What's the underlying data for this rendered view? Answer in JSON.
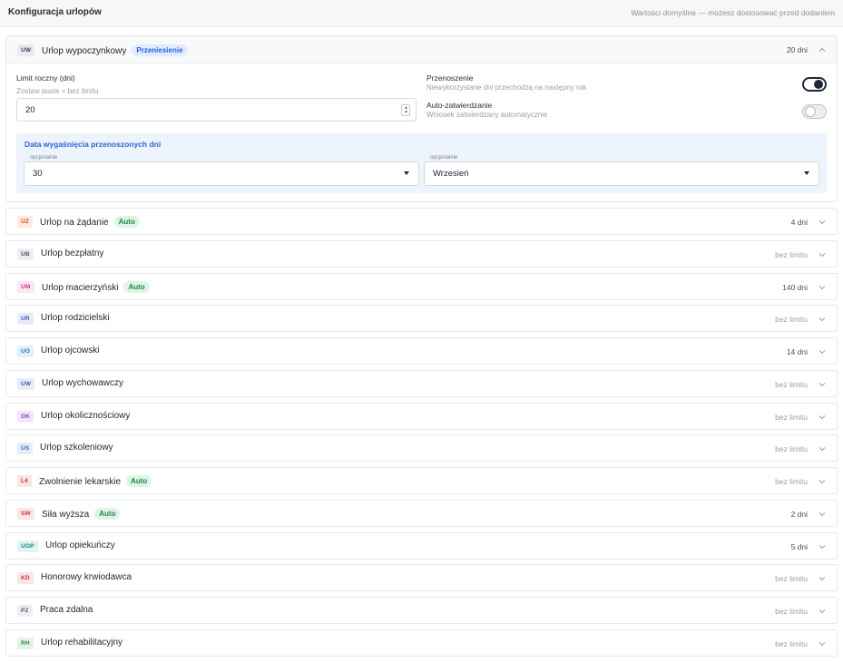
{
  "header": {
    "title": "Konfiguracja urlopów",
    "note": "Wartości domyślne — możesz dostosować przed dodaniem"
  },
  "expanded": {
    "abbr": "UW",
    "name": "Urlop wypoczynkowy",
    "badge": "Przeniesienie",
    "days": "20 dni",
    "limit_label": "Limit roczny (dni)",
    "limit_hint": "Zostaw puste = bez limitu",
    "limit_value": "20",
    "carry_label": "Przenoszenie",
    "carry_hint": "Niewykorzystane dni przechodzą na następny rok",
    "carry_on": true,
    "auto_label": "Auto-zatwierdzanie",
    "auto_hint": "Wniosek zatwierdzany automatycznie",
    "auto_on": false,
    "expiry_title": "Data wygaśnięcia przenoszonych dni",
    "day_caption": "opcjonalnie",
    "day_value": "30",
    "month_caption": "opcjonalnie",
    "month_value": "Wrzesień",
    "abbr_colors": {
      "bg": "#e9ebef",
      "fg": "#3d4250"
    }
  },
  "leaves": [
    {
      "abbr": "UŻ",
      "name": "Urlop na żądanie",
      "badge": "Auto",
      "days": "4 dni",
      "bg": "#fde9e1",
      "fg": "#d2562a"
    },
    {
      "abbr": "UB",
      "name": "Urlop bezpłatny",
      "badge": "",
      "days": "bez limitu",
      "bg": "#eceef1",
      "fg": "#4d5260"
    },
    {
      "abbr": "UM",
      "name": "Urlop macierzyński",
      "badge": "Auto",
      "days": "140 dni",
      "bg": "#fbe6f3",
      "fg": "#c2358d"
    },
    {
      "abbr": "UR",
      "name": "Urlop rodzicielski",
      "badge": "",
      "days": "bez limitu",
      "bg": "#e8ebfb",
      "fg": "#4a57b8"
    },
    {
      "abbr": "UO",
      "name": "Urlop ojcowski",
      "badge": "",
      "days": "14 dni",
      "bg": "#e1f0fb",
      "fg": "#2477b8"
    },
    {
      "abbr": "UW",
      "name": "Urlop wychowawczy",
      "badge": "",
      "days": "bez limitu",
      "bg": "#e8ebf8",
      "fg": "#4458a8"
    },
    {
      "abbr": "OK",
      "name": "Urlop okolicznościowy",
      "badge": "",
      "days": "bez limitu",
      "bg": "#f1e6fb",
      "fg": "#8a3bc4"
    },
    {
      "abbr": "US",
      "name": "Urlop szkoleniowy",
      "badge": "",
      "days": "bez limitu",
      "bg": "#e4eefb",
      "fg": "#2f6db8"
    },
    {
      "abbr": "L4",
      "name": "Zwolnienie lekarskie",
      "badge": "Auto",
      "days": "bez limitu",
      "bg": "#fde4e4",
      "fg": "#cc3535"
    },
    {
      "abbr": "SW",
      "name": "Siła wyższa",
      "badge": "Auto",
      "days": "2 dni",
      "bg": "#fde6e6",
      "fg": "#c93a3a"
    },
    {
      "abbr": "UOP",
      "name": "Urlop opiekuńczy",
      "badge": "",
      "days": "5 dni",
      "bg": "#e1f2f4",
      "fg": "#1f7d88"
    },
    {
      "abbr": "KD",
      "name": "Honorowy krwiodawca",
      "badge": "",
      "days": "bez limitu",
      "bg": "#fde4e8",
      "fg": "#cc3350"
    },
    {
      "abbr": "PZ",
      "name": "Praca zdalna",
      "badge": "",
      "days": "bez limitu",
      "bg": "#eceef2",
      "fg": "#535866"
    },
    {
      "abbr": "RH",
      "name": "Urlop rehabilitacyjny",
      "badge": "",
      "days": "bez limitu",
      "bg": "#e3f4e6",
      "fg": "#2f8a43"
    }
  ],
  "colors": {
    "auto_badge_bg": "#ddf5e5",
    "auto_badge_fg": "#1d8a45",
    "carry_badge_bg": "#e1ecff",
    "carry_badge_fg": "#2c62d3",
    "accent": "#2c62d3"
  },
  "icons": {
    "collapse": "chevron-up-icon",
    "expand": "chevron-down-icon",
    "dropdown": "caret-down-icon",
    "stepper": "stepper-icon"
  }
}
